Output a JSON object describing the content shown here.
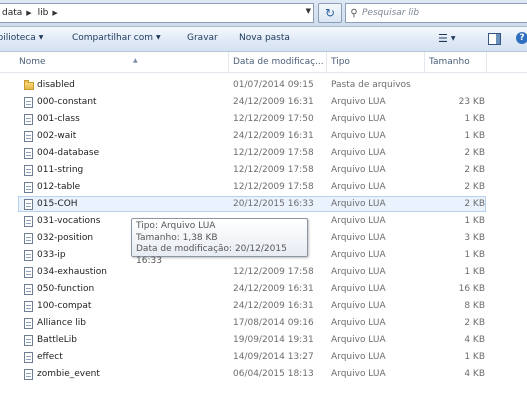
{
  "address_bar": {
    "crumbs": [
      "data",
      "lib"
    ],
    "search_placeholder": "Pesquisar lib"
  },
  "command_bar": {
    "library": "ibilioteca",
    "share": "Compartilhar com",
    "burn": "Gravar",
    "new_folder": "Nova pasta"
  },
  "columns": {
    "name": "Nome",
    "date": "Data de modificaç...",
    "type": "Tipo",
    "size": "Tamanho"
  },
  "files": [
    {
      "name": "disabled",
      "date": "01/07/2014 09:15",
      "type": "Pasta de arquivos",
      "size": "",
      "icon": "folder-icon"
    },
    {
      "name": "000-constant",
      "date": "24/12/2009 16:31",
      "type": "Arquivo LUA",
      "size": "23 KB",
      "icon": "file-icon"
    },
    {
      "name": "001-class",
      "date": "12/12/2009 17:50",
      "type": "Arquivo LUA",
      "size": "1 KB",
      "icon": "file-icon"
    },
    {
      "name": "002-wait",
      "date": "24/12/2009 16:31",
      "type": "Arquivo LUA",
      "size": "1 KB",
      "icon": "file-icon"
    },
    {
      "name": "004-database",
      "date": "12/12/2009 17:58",
      "type": "Arquivo LUA",
      "size": "2 KB",
      "icon": "file-icon"
    },
    {
      "name": "011-string",
      "date": "12/12/2009 17:58",
      "type": "Arquivo LUA",
      "size": "2 KB",
      "icon": "file-icon"
    },
    {
      "name": "012-table",
      "date": "12/12/2009 17:58",
      "type": "Arquivo LUA",
      "size": "2 KB",
      "icon": "file-icon"
    },
    {
      "name": "015-COH",
      "date": "20/12/2015 16:33",
      "type": "Arquivo LUA",
      "size": "2 KB",
      "icon": "file-icon",
      "selected": true
    },
    {
      "name": "031-vocations",
      "date": "",
      "type": "Arquivo LUA",
      "size": "1 KB",
      "icon": "file-icon"
    },
    {
      "name": "032-position",
      "date": "",
      "type": "Arquivo LUA",
      "size": "3 KB",
      "icon": "file-icon"
    },
    {
      "name": "033-ip",
      "date": "",
      "type": "Arquivo LUA",
      "size": "1 KB",
      "icon": "file-icon"
    },
    {
      "name": "034-exhaustion",
      "date": "12/12/2009 17:58",
      "type": "Arquivo LUA",
      "size": "1 KB",
      "icon": "file-icon"
    },
    {
      "name": "050-function",
      "date": "24/12/2009 16:31",
      "type": "Arquivo LUA",
      "size": "16 KB",
      "icon": "file-icon"
    },
    {
      "name": "100-compat",
      "date": "24/12/2009 16:31",
      "type": "Arquivo LUA",
      "size": "8 KB",
      "icon": "file-icon"
    },
    {
      "name": "Alliance lib",
      "date": "17/08/2014 09:16",
      "type": "Arquivo LUA",
      "size": "2 KB",
      "icon": "file-icon"
    },
    {
      "name": "BattleLib",
      "date": "19/09/2014 19:31",
      "type": "Arquivo LUA",
      "size": "4 KB",
      "icon": "file-icon"
    },
    {
      "name": "effect",
      "date": "14/09/2014 13:27",
      "type": "Arquivo LUA",
      "size": "1 KB",
      "icon": "file-icon"
    },
    {
      "name": "zombie_event",
      "date": "06/04/2015 18:13",
      "type": "Arquivo LUA",
      "size": "4 KB",
      "icon": "file-icon"
    }
  ],
  "tooltip": {
    "line1": "Tipo: Arquivo LUA",
    "line2": "Tamanho: 1,38 KB",
    "line3": "Data de modificação: 20/12/2015 16:33"
  }
}
